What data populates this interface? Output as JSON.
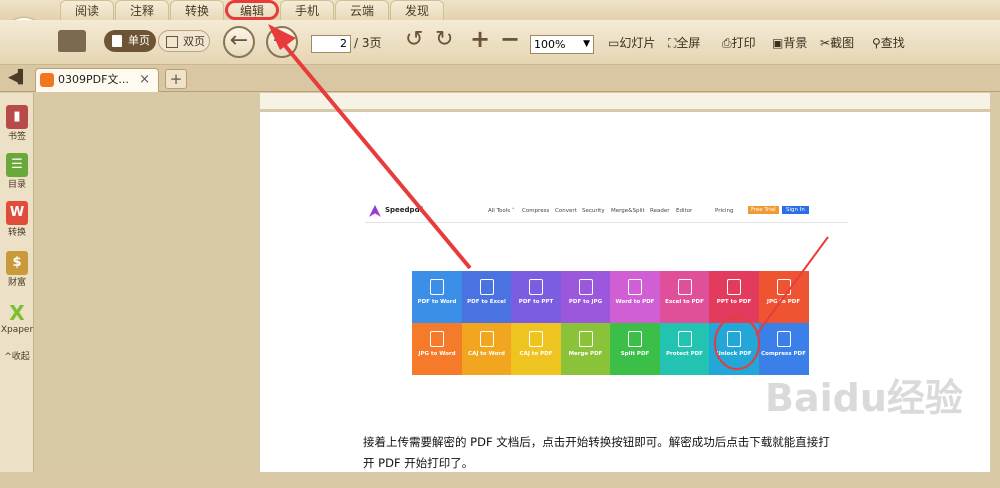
{
  "menu": {
    "tabs": [
      "阅读",
      "注释",
      "转换",
      "编辑",
      "手机",
      "云端",
      "发现"
    ]
  },
  "toolbar": {
    "single_page": "单页",
    "double_page": "双页",
    "page_current": "2",
    "page_total": "/ 3页",
    "zoom": "100%",
    "slideshow": "幻灯片",
    "fullscreen": "全屏",
    "print": "打印",
    "background": "背景",
    "screenshot": "截图",
    "find": "查找"
  },
  "tabs": {
    "doc_title": "0309PDF文...",
    "close": "×",
    "add": "+"
  },
  "sidebar": {
    "items": [
      "书签",
      "目录",
      "转换",
      "财富",
      "Xpaper"
    ],
    "collapse": "^收起"
  },
  "site": {
    "logo": "Speedpdf",
    "nav": [
      "All Tools ˅",
      "Compress",
      "Convert",
      "Security",
      "Merge&Split",
      "Reader",
      "Editor"
    ],
    "pricing": "Pricing",
    "free_trial": "Free Trial",
    "sign_in": "Sign In",
    "tiles": [
      {
        "label": "PDF to Word",
        "color": "#3b8fe6"
      },
      {
        "label": "PDF to Excel",
        "color": "#4a72e0"
      },
      {
        "label": "PDF to PPT",
        "color": "#7a5de0"
      },
      {
        "label": "PDF to JPG",
        "color": "#9c58dd"
      },
      {
        "label": "Word to PDF",
        "color": "#d05fd6"
      },
      {
        "label": "Excel to PDF",
        "color": "#e0509a"
      },
      {
        "label": "PPT to PDF",
        "color": "#e33b5d"
      },
      {
        "label": "JPG to PDF",
        "color": "#ef5432"
      },
      {
        "label": "JPG to Word",
        "color": "#f57a2a"
      },
      {
        "label": "CAJ to Word",
        "color": "#f2a51f"
      },
      {
        "label": "CAJ to PDF",
        "color": "#eec420"
      },
      {
        "label": "Merge PDF",
        "color": "#8ac23a"
      },
      {
        "label": "Split PDF",
        "color": "#3bbf49"
      },
      {
        "label": "Protect PDF",
        "color": "#22c3b0"
      },
      {
        "label": "Unlock PDF",
        "color": "#22a7d8"
      },
      {
        "label": "Compress PDF",
        "color": "#3b7fe8"
      }
    ]
  },
  "caption": {
    "line1": "接着上传需要解密的 PDF 文档后，点击开始转换按钮即可。解密成功后点击下载就能直接打",
    "line2": "开 PDF 开始打印了。"
  },
  "watermark": "Baidu经验"
}
